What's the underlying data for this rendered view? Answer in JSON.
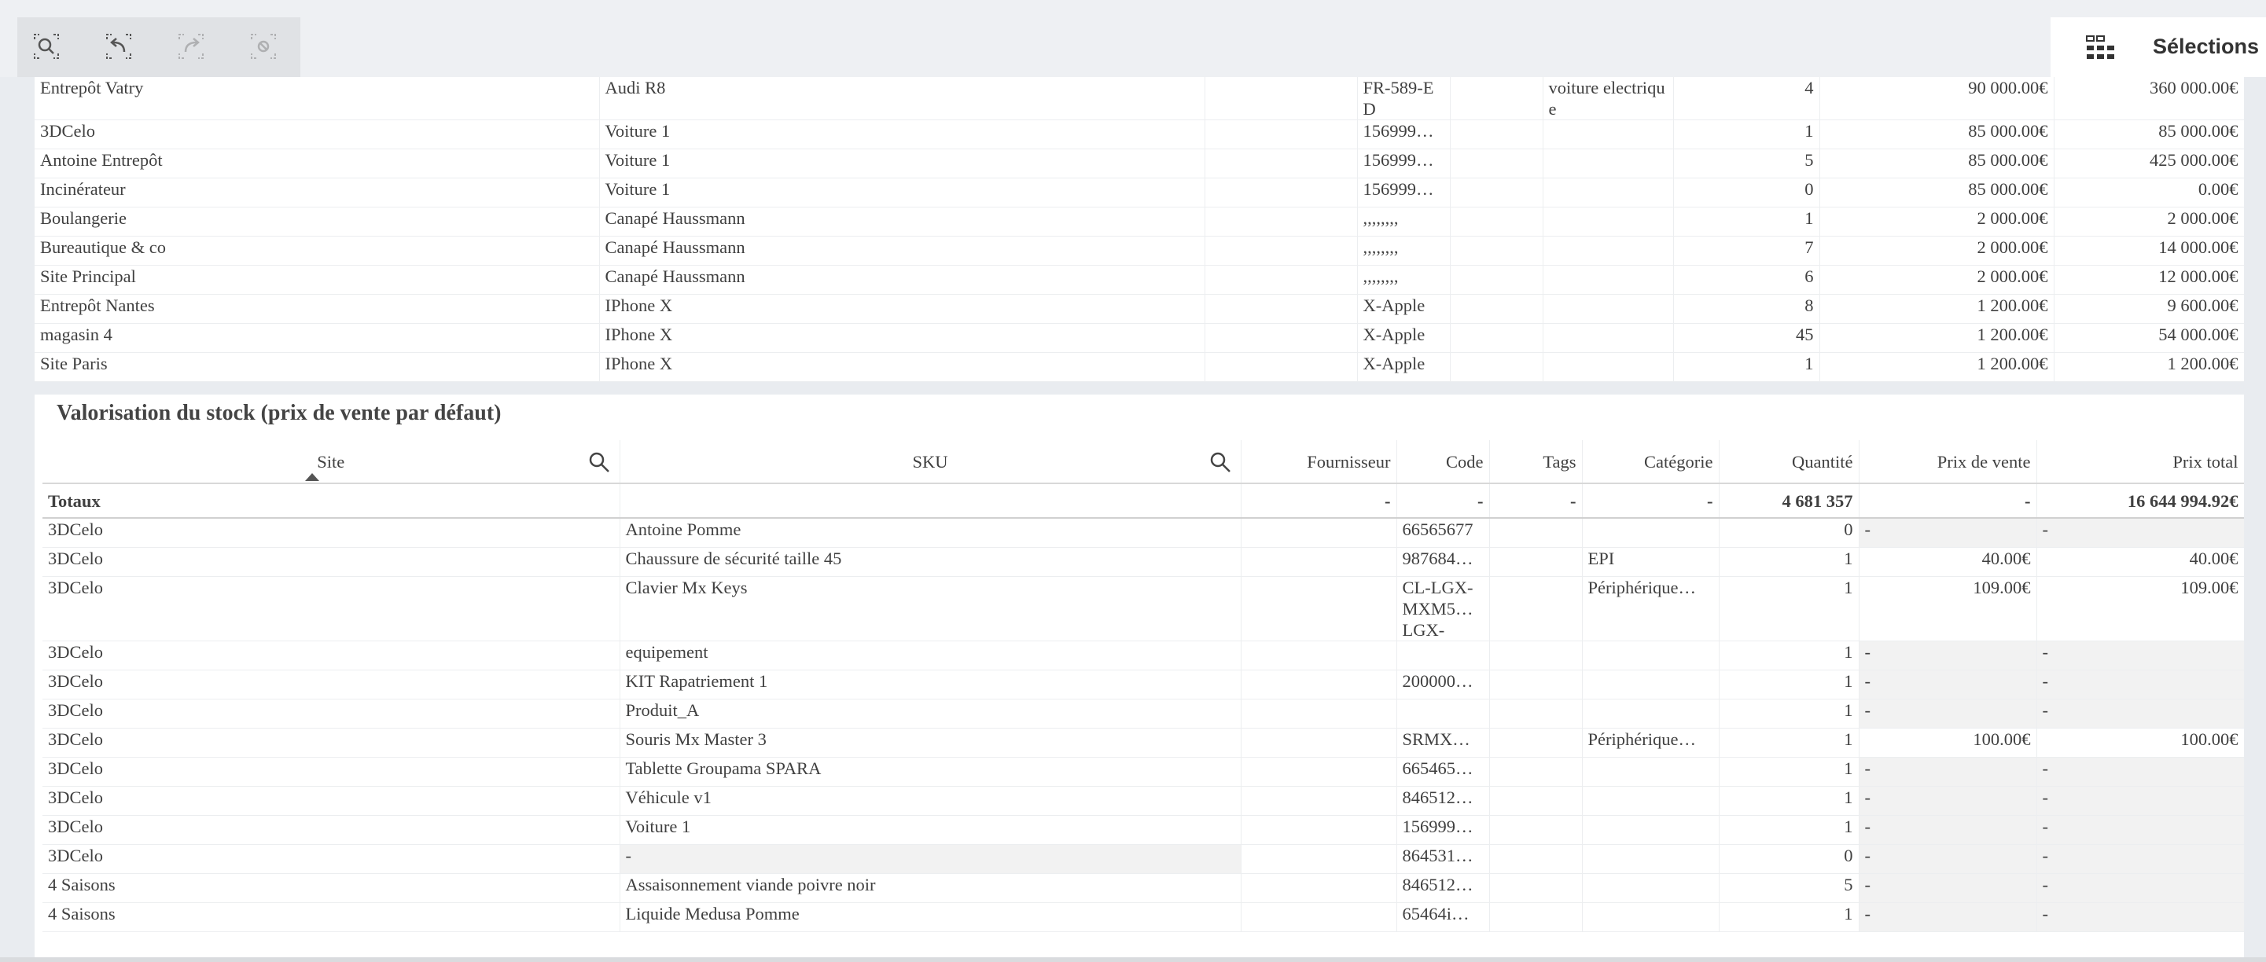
{
  "toolbar": {
    "buttons": [
      {
        "icon": "smart-search-icon",
        "enabled": true
      },
      {
        "icon": "step-back-icon",
        "enabled": true
      },
      {
        "icon": "step-forward-icon",
        "enabled": false
      },
      {
        "icon": "clear-selections-icon",
        "enabled": false
      }
    ],
    "selections_label": "Sélections",
    "selections_icon": "selections-grid-icon"
  },
  "top_table": {
    "rows": [
      {
        "site": "Entrepôt Vatry",
        "sku": "Audi R8",
        "fournisseur": "",
        "code": "FR-589-ED",
        "tags": "",
        "categorie": "voiture electrique",
        "quantite": "4",
        "prix_vente": "90 000.00€",
        "prix_total": "360 000.00€"
      },
      {
        "site": "3DCelo",
        "sku": "Voiture 1",
        "fournisseur": "",
        "code": "156999…",
        "tags": "",
        "categorie": "",
        "quantite": "1",
        "prix_vente": "85 000.00€",
        "prix_total": "85 000.00€"
      },
      {
        "site": "Antoine Entrepôt",
        "sku": "Voiture 1",
        "fournisseur": "",
        "code": "156999…",
        "tags": "",
        "categorie": "",
        "quantite": "5",
        "prix_vente": "85 000.00€",
        "prix_total": "425 000.00€"
      },
      {
        "site": "Incinérateur",
        "sku": "Voiture 1",
        "fournisseur": "",
        "code": "156999…",
        "tags": "",
        "categorie": "",
        "quantite": "0",
        "prix_vente": "85 000.00€",
        "prix_total": "0.00€"
      },
      {
        "site": "Boulangerie",
        "sku": "Canapé Haussmann",
        "fournisseur": "",
        "code": ",,,,,,,,",
        "tags": "",
        "categorie": "",
        "quantite": "1",
        "prix_vente": "2 000.00€",
        "prix_total": "2 000.00€"
      },
      {
        "site": "Bureautique & co",
        "sku": "Canapé Haussmann",
        "fournisseur": "",
        "code": ",,,,,,,,",
        "tags": "",
        "categorie": "",
        "quantite": "7",
        "prix_vente": "2 000.00€",
        "prix_total": "14 000.00€"
      },
      {
        "site": "Site Principal",
        "sku": "Canapé Haussmann",
        "fournisseur": "",
        "code": ",,,,,,,,",
        "tags": "",
        "categorie": "",
        "quantite": "6",
        "prix_vente": "2 000.00€",
        "prix_total": "12 000.00€"
      },
      {
        "site": "Entrepôt Nantes",
        "sku": "IPhone X",
        "fournisseur": "",
        "code": "X-Apple",
        "tags": "",
        "categorie": "",
        "quantite": "8",
        "prix_vente": "1 200.00€",
        "prix_total": "9 600.00€"
      },
      {
        "site": "magasin 4",
        "sku": "IPhone X",
        "fournisseur": "",
        "code": "X-Apple",
        "tags": "",
        "categorie": "",
        "quantite": "45",
        "prix_vente": "1 200.00€",
        "prix_total": "54 000.00€"
      },
      {
        "site": "Site Paris",
        "sku": "IPhone X",
        "fournisseur": "",
        "code": "X-Apple",
        "tags": "",
        "categorie": "",
        "quantite": "1",
        "prix_vente": "1 200.00€",
        "prix_total": "1 200.00€"
      }
    ]
  },
  "bottom_table": {
    "title": "Valorisation du stock (prix de vente par défaut)",
    "columns": {
      "site": "Site",
      "sku": "SKU",
      "fournisseur": "Fournisseur",
      "code": "Code",
      "tags": "Tags",
      "categorie": "Catégorie",
      "quantite": "Quantité",
      "prix_vente": "Prix de vente",
      "prix_total": "Prix total"
    },
    "totals": {
      "label": "Totaux",
      "fournisseur": "-",
      "code": "-",
      "tags": "-",
      "categorie": "-",
      "quantite": "4 681 357",
      "prix_vente": "-",
      "prix_total": "16 644 994.92€"
    },
    "rows": [
      {
        "site": "3DCelo",
        "sku": "Antoine Pomme",
        "fournisseur": "",
        "code": "66565677",
        "tags": "",
        "categorie": "",
        "quantite": "0",
        "prix_vente": "-",
        "prix_total": "-"
      },
      {
        "site": "3DCelo",
        "sku": "Chaussure de sécurité taille 45",
        "fournisseur": "",
        "code": "987684…",
        "tags": "",
        "categorie": "EPI",
        "quantite": "1",
        "prix_vente": "40.00€",
        "prix_total": "40.00€"
      },
      {
        "site": "3DCelo",
        "sku": "Clavier Mx Keys",
        "fournisseur": "",
        "code": "CL-LGX-MXM5… LGX-",
        "tags": "",
        "categorie": "Périphérique…",
        "quantite": "1",
        "prix_vente": "109.00€",
        "prix_total": "109.00€"
      },
      {
        "site": "3DCelo",
        "sku": "equipement",
        "fournisseur": "",
        "code": "",
        "tags": "",
        "categorie": "",
        "quantite": "1",
        "prix_vente": "-",
        "prix_total": "-"
      },
      {
        "site": "3DCelo",
        "sku": "KIT Rapatriement 1",
        "fournisseur": "",
        "code": "200000…",
        "tags": "",
        "categorie": "",
        "quantite": "1",
        "prix_vente": "-",
        "prix_total": "-"
      },
      {
        "site": "3DCelo",
        "sku": "Produit_A",
        "fournisseur": "",
        "code": "",
        "tags": "",
        "categorie": "",
        "quantite": "1",
        "prix_vente": "-",
        "prix_total": "-"
      },
      {
        "site": "3DCelo",
        "sku": "Souris Mx Master 3",
        "fournisseur": "",
        "code": "SRMX…",
        "tags": "",
        "categorie": "Périphérique…",
        "quantite": "1",
        "prix_vente": "100.00€",
        "prix_total": "100.00€"
      },
      {
        "site": "3DCelo",
        "sku": "Tablette Groupama SPARA",
        "fournisseur": "",
        "code": "665465…",
        "tags": "",
        "categorie": "",
        "quantite": "1",
        "prix_vente": "-",
        "prix_total": "-"
      },
      {
        "site": "3DCelo",
        "sku": "Véhicule v1",
        "fournisseur": "",
        "code": "846512…",
        "tags": "",
        "categorie": "",
        "quantite": "1",
        "prix_vente": "-",
        "prix_total": "-"
      },
      {
        "site": "3DCelo",
        "sku": "Voiture 1",
        "fournisseur": "",
        "code": "156999…",
        "tags": "",
        "categorie": "",
        "quantite": "1",
        "prix_vente": "-",
        "prix_total": "-"
      },
      {
        "site": "3DCelo",
        "sku": "-",
        "fournisseur": "",
        "code": "864531…",
        "tags": "",
        "categorie": "",
        "quantite": "0",
        "prix_vente": "-",
        "prix_total": "-"
      },
      {
        "site": "4 Saisons",
        "sku": "Assaisonnement viande poivre noir",
        "fournisseur": "",
        "code": "846512…",
        "tags": "",
        "categorie": "",
        "quantite": "5",
        "prix_vente": "-",
        "prix_total": "-"
      },
      {
        "site": "4 Saisons",
        "sku": "Liquide Medusa Pomme",
        "fournisseur": "",
        "code": "65464i…",
        "tags": "",
        "categorie": "",
        "quantite": "1",
        "prix_vente": "-",
        "prix_total": "-"
      }
    ]
  }
}
